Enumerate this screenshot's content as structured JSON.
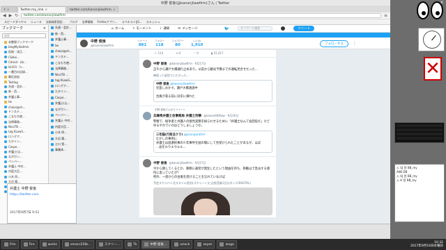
{
  "browser": {
    "window_title": "中野 俊後(@kanonjilawfirm)さん | Twitter",
    "tabs": [
      {
        "label": "t",
        "active": false
      },
      {
        "label": "Twitter.my_link",
        "active": true
      },
      {
        "label": "twitter.com/kanonjilawfirm",
        "active": false
      }
    ],
    "address": "twitter.com/kanonjilawfirm",
    "bookmarks": [
      "スピードダイヤル",
      "ニュース",
      "法務検索固定...",
      "ブログ",
      "法律情報",
      "Firefoxアプリ...",
      "コペキコミ(JS...",
      "スラッシュ"
    ]
  },
  "sidebar": {
    "header": "ブックマーク",
    "search_placeholder": "検索",
    "items": [
      {
        "label": "未整理ブックマーク",
        "folder": true
      },
      {
        "label": "blogMy4admin",
        "folder": false
      },
      {
        "label": "役務・改正...",
        "folder": false
      },
      {
        "label": "C&Kai...",
        "folder": false
      },
      {
        "label": "Cdroid - (br...",
        "folder": false
      },
      {
        "label": "kk101 - h...",
        "folder": false
      },
      {
        "label": "一番目の記録...",
        "folder": false
      },
      {
        "label": "最近追加",
        "folder": true
      },
      {
        "label": "Twitlog",
        "folder": true
      },
      {
        "label": "先週・会計...",
        "folder": false
      },
      {
        "label": "新・西...",
        "folder": false
      },
      {
        "label": "弁護士事...",
        "folder": false
      },
      {
        "label": "tw",
        "folder": true
      },
      {
        "label": "choiai@ch...",
        "folder": false
      },
      {
        "label": "ドンステ...",
        "folder": false
      },
      {
        "label": "こなもち使...",
        "folder": false
      },
      {
        "label": "法律事務...",
        "folder": false
      },
      {
        "label": "NicoTB ...",
        "folder": false
      },
      {
        "label": "tag KLowS...",
        "folder": false
      },
      {
        "label": "ロングア...",
        "folder": false
      },
      {
        "label": "たかリン...",
        "folder": false
      },
      {
        "label": "Caspe...",
        "folder": false
      },
      {
        "label": "弁護士(山...",
        "folder": false
      },
      {
        "label": "ながガン...",
        "folder": false
      },
      {
        "label": "ペンバー...",
        "folder": false
      },
      {
        "label": "弁護士 中村...",
        "folder": false
      },
      {
        "label": "内容大臣...",
        "folder": false
      },
      {
        "label": "小木 四...",
        "folder": false
      },
      {
        "label": "大沢 蔵...",
        "folder": false
      },
      {
        "label": "江口 賢...",
        "folder": false
      },
      {
        "label": "事業体...",
        "folder": false
      }
    ]
  },
  "preview": {
    "title": "弁護士 中野 俊後",
    "url": "https://twitter.com",
    "date": "2017年9月7日 9:52"
  },
  "twitter": {
    "nav": {
      "home": "ホーム",
      "moments": "モーメント",
      "notifications": "通知",
      "messages": "メッセージ",
      "search_placeholder": "キーワード検索",
      "tweet_button": "ツイート"
    },
    "profile": {
      "name": "中野 俊後",
      "handle": "@kanonjilawfirm",
      "follow_button": "フォローする"
    },
    "stats": [
      {
        "label": "ツイート",
        "value": "881"
      },
      {
        "label": "フォロー",
        "value": "118"
      },
      {
        "label": "フォロワー",
        "value": "80"
      },
      {
        "label": "いいね",
        "value": "1,910"
      }
    ],
    "top_actions": {
      "replies": "114",
      "retweets": "0",
      "likes": "0",
      "views": "15,417"
    },
    "tweets": [
      {
        "context": "",
        "name": "中野 俊後",
        "meta": "@kanonjilawfirm · 9月17日",
        "body": "正午から瀬戸大橋通行止めあり。以前から観光予算までの運転見合せだった...",
        "reply_to": "",
        "quote": {
          "name": "中野 俊後",
          "handle": "@kanonjilawfirm",
          "text": "児島しおかす。瀬戸大橋通過中\n\n台風が来る前に対岸に帰れた"
        },
        "note": "練習って返信でいたかった...",
        "photo": false
      },
      {
        "context": "中野 俊後さんがリツイート",
        "name": "兵庫県弁護士会事務局 弁護士刑事",
        "meta": "@kanon666law · 9月16日",
        "body": "警察で、紛争者と弁護人の接見実務を紛らわせるために「弁護士なんて会話役だ」けどゆるやかでいかはどうしましょうか。",
        "reply_to": "",
        "quote": {
          "name": "三毛猫(行政法クラ)",
          "handle": "@pronpanther",
          "text": "むかしの事例に\n弁護士は国選刑事の少年事件を国の場にして見受けられたことがあるが、ほぼ\n...会をわりエウエル..."
        },
        "note": "",
        "photo": false
      },
      {
        "context": "",
        "name": "中野 俊後",
        "meta": "@kanonjilawfirm · 9月17日",
        "body": "今から期してくるとか、東側に通常が発生したという理由を持ち、移動はで急派する感持に思っていたが？\n県外、一部からの台風を受けることを忘れていなけば",
        "reply_to": "",
        "quote": null,
        "note": "予定スケジバイ北スタイル急別(ゴチャート)に出投音楽1日分ダンデIDIGITAL)",
        "photo": true
      }
    ]
  },
  "taskbar": {
    "items": [
      "Prin",
      "Fire",
      "works",
      "emacs258s...",
      "スクリー...",
      "Tk",
      "中野 俊後...",
      "xclock",
      "xeyes",
      "xlogo"
    ],
    "clock": "10:32\n2017年9月16日水曜日"
  },
  "widgets": {
    "sticky_lines": [
      "入 UJ 目 BB_my",
      "ANS DB",
      "入 UJ 目 BB_my",
      "入 H 目 BB_my"
    ],
    "close_label": "×"
  }
}
